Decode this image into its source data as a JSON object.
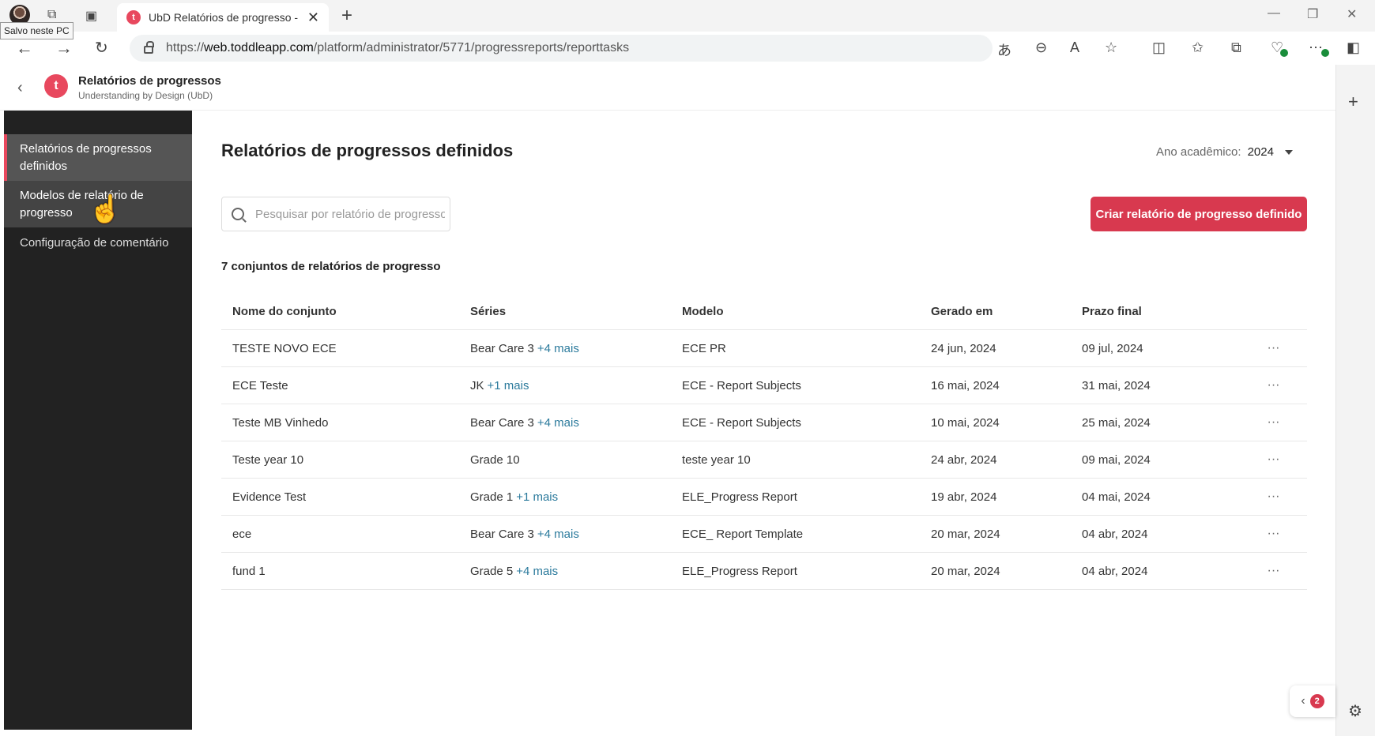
{
  "browser": {
    "tab_title": "UbD Relatórios de progresso - Re",
    "tooltip": "Salvo neste PC",
    "url_prefix": "https://",
    "url_host": "web.toddleapp.com",
    "url_path": "/platform/administrator/5771/progressreports/reporttasks",
    "favicon_letter": "t",
    "help_badge_count": "2"
  },
  "app": {
    "logo_letter": "t",
    "title": "Relatórios de progressos",
    "subtitle": "Understanding by Design (UbD)"
  },
  "sidebar": {
    "items": [
      {
        "label": "Relatórios de progressos definidos"
      },
      {
        "label": "Modelos de relatório de progresso"
      },
      {
        "label": "Configuração de comentário"
      }
    ]
  },
  "main": {
    "title": "Relatórios de progressos definidos",
    "year_label": "Ano acadêmico:",
    "year_value": "2024",
    "search_placeholder": "Pesquisar por relatório de progresso",
    "create_button": "Criar relatório de progresso definido",
    "count_text": "7 conjuntos de relatórios de progresso",
    "columns": [
      "Nome do conjunto",
      "Séries",
      "Modelo",
      "Gerado em",
      "Prazo final"
    ],
    "rows": [
      {
        "name": "TESTE NOVO ECE",
        "series": "Bear Care 3",
        "more": "+4 mais",
        "model": "ECE PR",
        "generated": "24 jun, 2024",
        "deadline": "09 jul, 2024"
      },
      {
        "name": "ECE Teste",
        "series": "JK",
        "more": "+1 mais",
        "model": "ECE - Report Subjects",
        "generated": "16 mai, 2024",
        "deadline": "31 mai, 2024"
      },
      {
        "name": "Teste MB Vinhedo",
        "series": "Bear Care 3",
        "more": "+4 mais",
        "model": "ECE - Report Subjects",
        "generated": "10 mai, 2024",
        "deadline": "25 mai, 2024"
      },
      {
        "name": "Teste year 10",
        "series": "Grade 10",
        "more": "",
        "model": "teste year 10",
        "generated": "24 abr, 2024",
        "deadline": "09 mai, 2024"
      },
      {
        "name": "Evidence Test",
        "series": "Grade 1",
        "more": "+1 mais",
        "model": "ELE_Progress Report",
        "generated": "19 abr, 2024",
        "deadline": "04 mai, 2024"
      },
      {
        "name": "ece",
        "series": "Bear Care 3",
        "more": "+4 mais",
        "model": "ECE_ Report Template",
        "generated": "20 mar, 2024",
        "deadline": "04 abr, 2024"
      },
      {
        "name": "fund 1",
        "series": "Grade 5",
        "more": "+4 mais",
        "model": "ELE_Progress Report",
        "generated": "20 mar, 2024",
        "deadline": "04 abr, 2024"
      }
    ],
    "row_menu": "···"
  }
}
